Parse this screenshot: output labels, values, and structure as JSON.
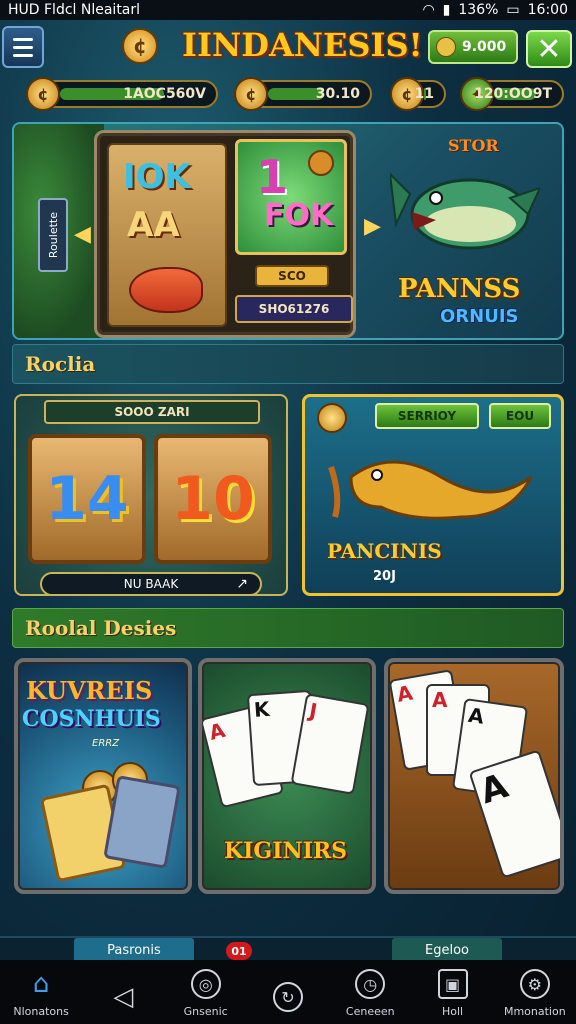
{
  "status_bar": {
    "left": "HUD Fldcl Nleaitarl",
    "battery": "136%",
    "time": "16:00"
  },
  "header": {
    "title": "IINDANESIS!",
    "coin_balance": "9.000",
    "close_label": "✕"
  },
  "resources": [
    {
      "icon": "coin-icon",
      "value": "1AOC560V",
      "fill": 0.7
    },
    {
      "icon": "coin-icon",
      "value": "30.10",
      "fill": 0.6
    },
    {
      "icon": "coin-icon",
      "value": "11",
      "fill": 0.2
    },
    {
      "icon": "leaf-coin-icon",
      "value": "120:OO9T",
      "fill": 0.7
    }
  ],
  "banner": {
    "side_tab": "Roulette",
    "reel_text_1": "IOK",
    "reel_text_2": "AA",
    "reel_text_3": "1",
    "reel_text_4": "FOK",
    "small_value": "SCO",
    "jackpot_value": "SHO61276",
    "badge": "STOR",
    "title": "PANNSS",
    "subtitle": "ORNUIS"
  },
  "section1": {
    "title": "Roclia"
  },
  "panel_left": {
    "header": "SOOO ZARI",
    "num1": "14",
    "num2": "10",
    "footer": "NU BAAK",
    "footer_arrow": "↗"
  },
  "panel_right": {
    "btn1": "SERRIOY",
    "btn2": "EOU",
    "title": "PANCINIS",
    "value": "20J"
  },
  "section2": {
    "title": "Roolal Desies"
  },
  "games": [
    {
      "title_1": "KUVREIS",
      "title_2": "COSNHUIS",
      "tag": "ERRZ"
    },
    {
      "title": "KIGINIRS",
      "cards": [
        "A",
        "K",
        "J"
      ]
    },
    {
      "cards": [
        "A",
        "A",
        "A",
        "A"
      ]
    }
  ],
  "bottom_tabs": {
    "left": "Pasronis",
    "badge": "01",
    "right": "Egeloo"
  },
  "nav": [
    {
      "label": "Nlonatons",
      "icon": "home-icon"
    },
    {
      "label": "",
      "icon": "back-icon"
    },
    {
      "label": "Gnsenic",
      "icon": "globe-icon"
    },
    {
      "label": "",
      "icon": "refresh-icon"
    },
    {
      "label": "Ceneeen",
      "icon": "clock-icon"
    },
    {
      "label": "Holl",
      "icon": "wallet-icon"
    },
    {
      "label": "Mmonation",
      "icon": "settings-icon"
    }
  ],
  "colors": {
    "accent_gold": "#ffc81e",
    "panel_green": "#2d7a16",
    "nav_home": "#3f9de8"
  }
}
